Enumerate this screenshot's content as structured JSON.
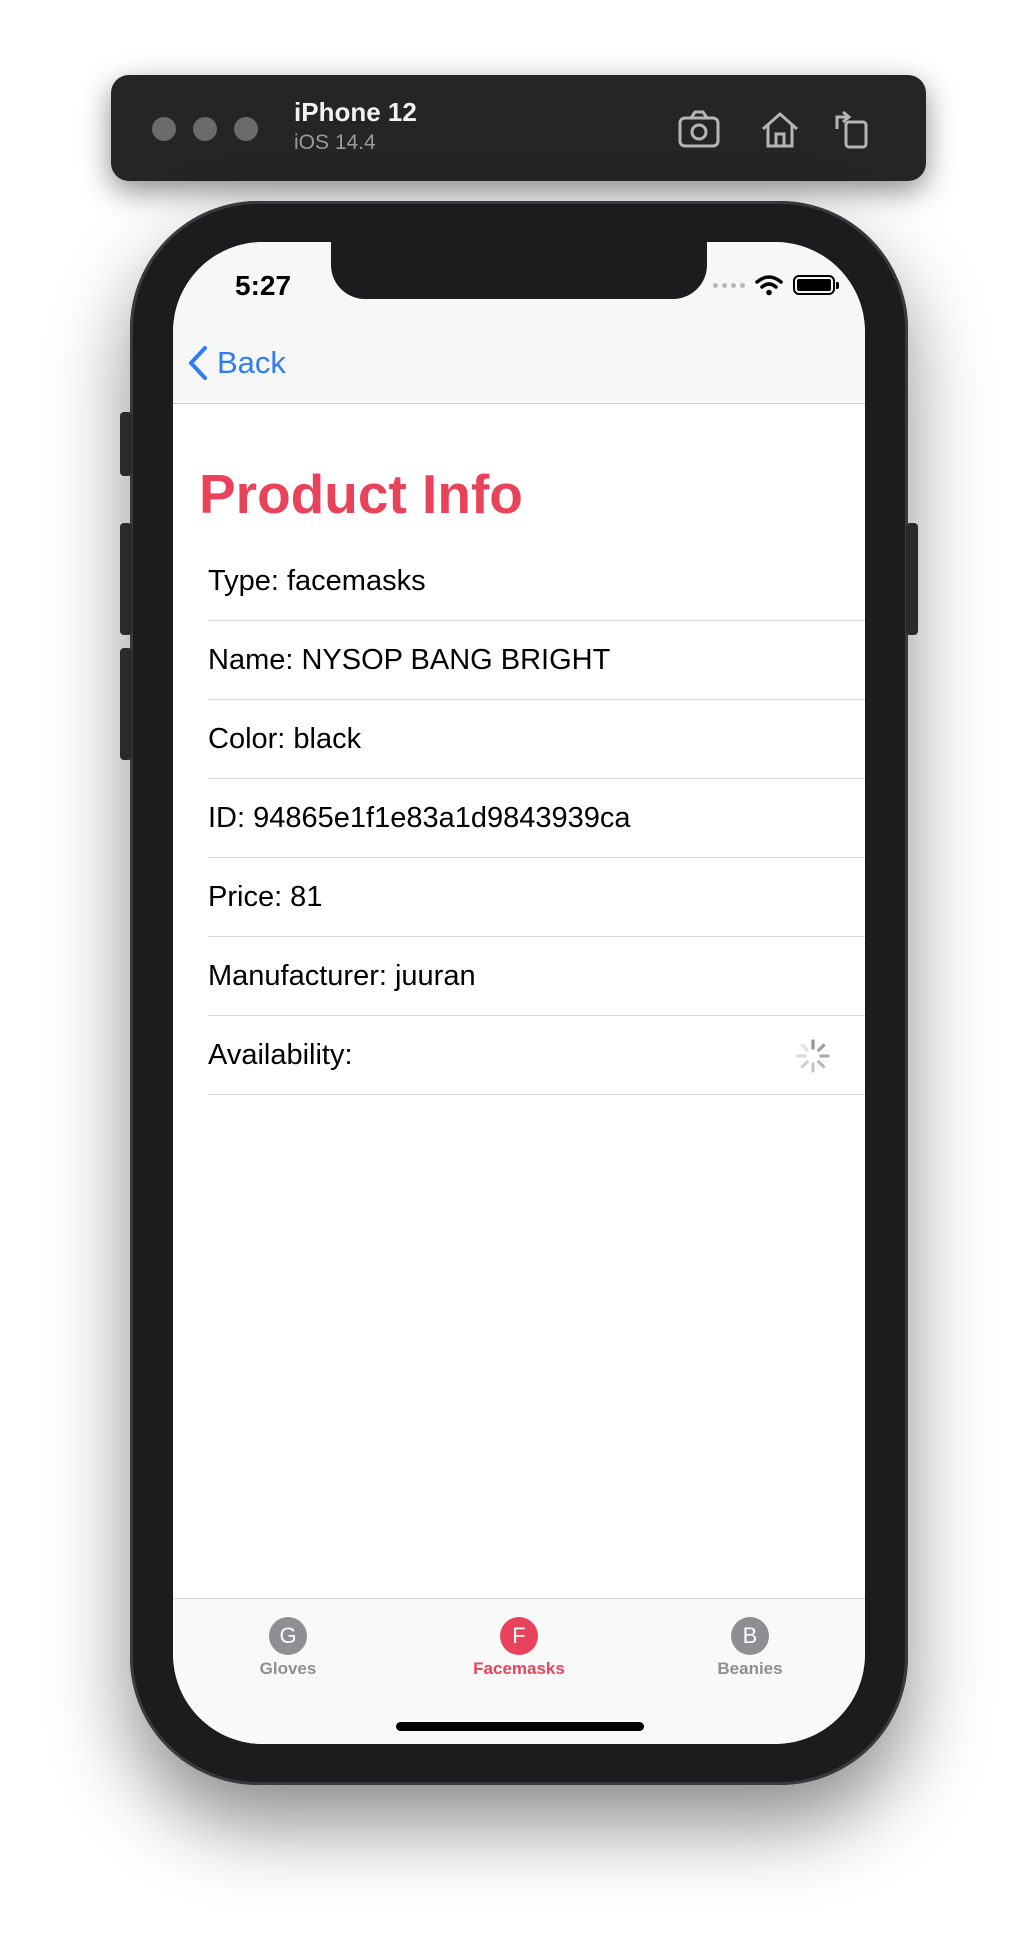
{
  "simulator": {
    "device_name": "iPhone 12",
    "os_version": "iOS 14.4",
    "tools": [
      "screenshot-icon",
      "home-icon",
      "rotate-icon"
    ]
  },
  "status_bar": {
    "time": "5:27"
  },
  "nav": {
    "back_label": "Back"
  },
  "page": {
    "title": "Product Info"
  },
  "rows": [
    {
      "text": "Type: facemasks"
    },
    {
      "text": "Name: NYSOP BANG BRIGHT"
    },
    {
      "text": "Color: black"
    },
    {
      "text": "ID: 94865e1f1e83a1d9843939ca"
    },
    {
      "text": "Price: 81"
    },
    {
      "text": "Manufacturer: juuran"
    },
    {
      "text": "Availability:",
      "loading": true
    }
  ],
  "tabs": [
    {
      "letter": "G",
      "label": "Gloves",
      "active": false
    },
    {
      "letter": "F",
      "label": "Facemasks",
      "active": true
    },
    {
      "letter": "B",
      "label": "Beanies",
      "active": false
    }
  ],
  "colors": {
    "accent": "#e8435a",
    "link": "#2f7cf6",
    "inactive_tab": "#8e8e93"
  }
}
